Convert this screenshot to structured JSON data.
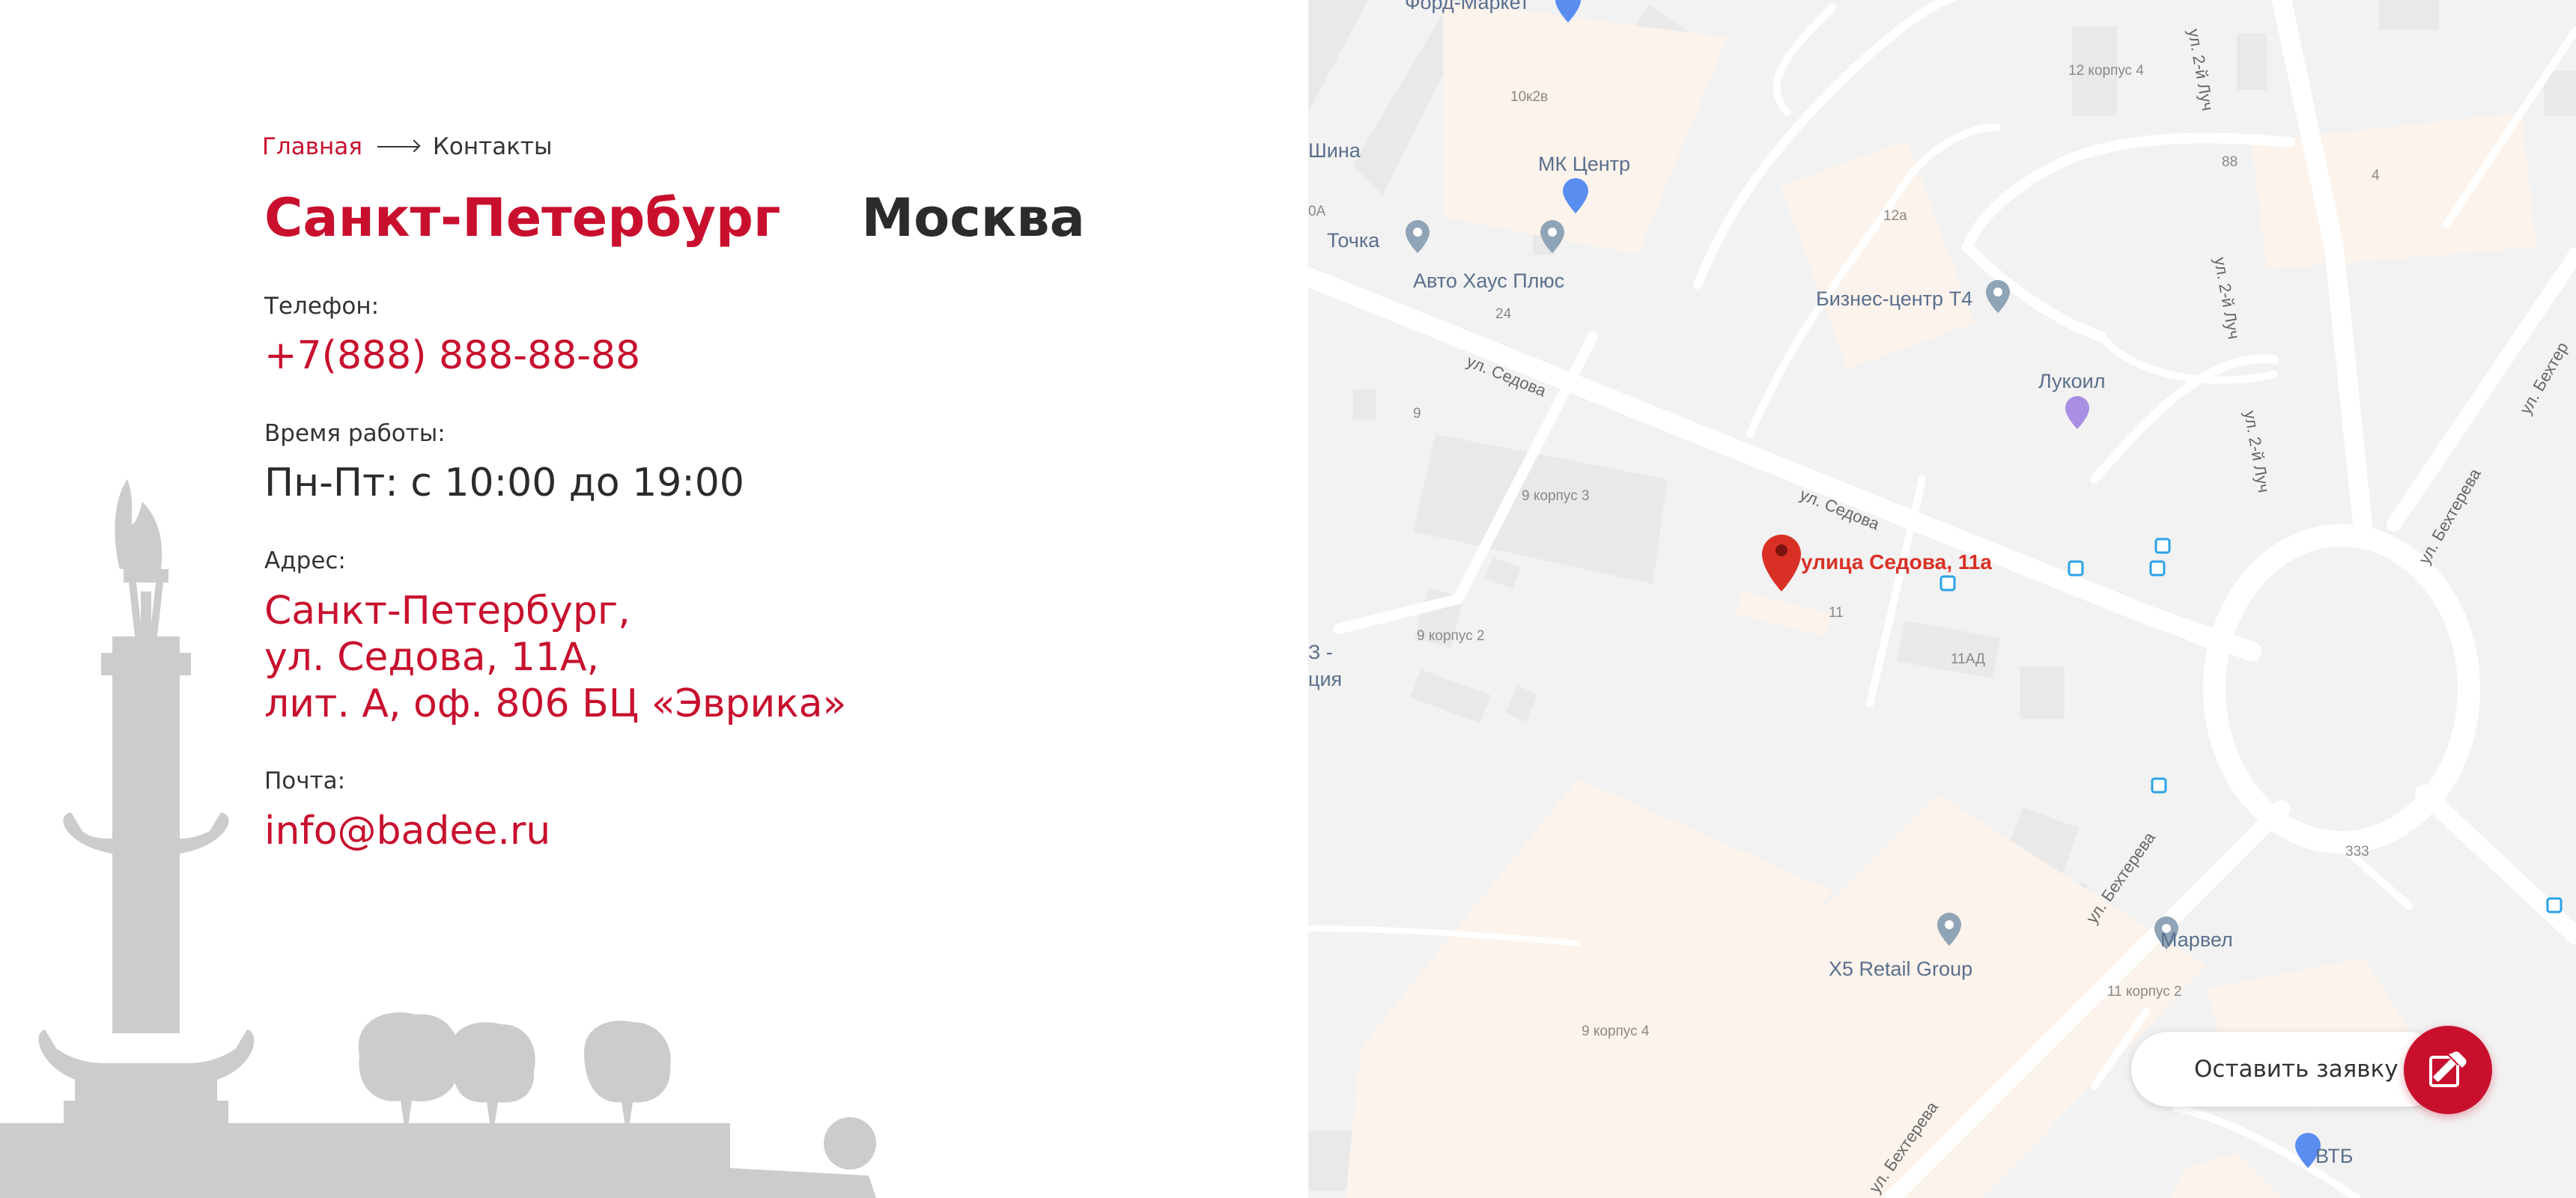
{
  "breadcrumb": {
    "home": "Главная",
    "current": "Контакты"
  },
  "cities": [
    {
      "label": "Санкт-Петербург",
      "active": true
    },
    {
      "label": "Москва",
      "active": false
    }
  ],
  "contacts": {
    "phone_label": "Телефон:",
    "phone": "+7(888) 888-88-88",
    "hours_label": "Время работы:",
    "hours": "Пн-Пт: с 10:00 до 19:00",
    "address_label": "Адрес:",
    "address_lines": [
      "Санкт-Петербург,",
      "ул. Седова, 11А,",
      "лит. А, оф. 806 БЦ «Эврика»"
    ],
    "email_label": "Почта:",
    "email": "info@badee.ru"
  },
  "map": {
    "marker_label": "улица Седова, 11а",
    "places": {
      "ford": "Форд-Маркет",
      "shina": "Шина",
      "mk": "МК Центр",
      "tochka": "Точка",
      "avtohaus": "Авто Хаус Плюс",
      "bc": "Бизнес-центр Т4",
      "lukoil": "Лукоил",
      "x5": "X5 Retail Group",
      "marvel": "Марвел",
      "vtb": "ВТБ",
      "z_frag1": "З -",
      "z_frag2": "ция"
    },
    "streets": {
      "sedova1": "ул. Седова",
      "sedova2": "ул. Седова",
      "luch1": "ул. 2-й Луч",
      "luch2": "ул. 2-й Луч",
      "luch3": "ул. 2-й Луч",
      "bekhtereva1": "ул. Бехтерева",
      "bekhtereva2": "ул. Бехтерева",
      "bekhtereva3": "ул. Бехтерева",
      "bekhtereva4": "ул. Бехтер"
    },
    "numbers": {
      "n12k4": "12 корпус 4",
      "n10k2v": "10к2в",
      "n88": "88",
      "n4": "4",
      "n12a": "12а",
      "n24": "24",
      "n0a": "0А",
      "n9": "9",
      "n9k3": "9 корпус 3",
      "n9k2": "9 корпус 2",
      "n11": "11",
      "n11ad": "11АД",
      "n333": "333",
      "n11k2": "11 корпус 2",
      "n9k4": "9 корпус 4"
    }
  },
  "cta": {
    "label": "Оставить заявку"
  },
  "colors": {
    "accent": "#c8102e",
    "text": "#2b2b2b",
    "silhouette": "#cccccc",
    "map_bg": "#f2f2f2",
    "road": "#ffffff",
    "poi": "#8fa4b6"
  }
}
